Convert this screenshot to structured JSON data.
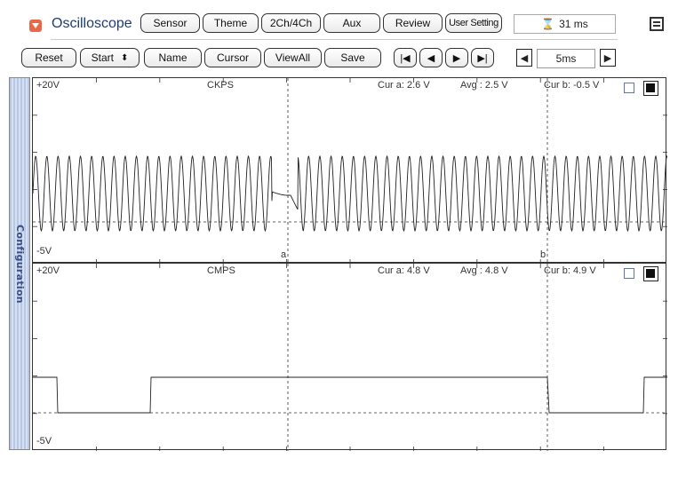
{
  "app": {
    "title": "Oscilloscope",
    "icon": "dropdown-arrow-icon"
  },
  "top_buttons": [
    "Sensor",
    "Theme",
    "2Ch/4Ch",
    "Aux",
    "Review",
    "User Setting"
  ],
  "time_display": {
    "value": "31 ms",
    "icon": "hourglass-icon"
  },
  "second_buttons": {
    "reset": "Reset",
    "start": "Start",
    "name": "Name",
    "cursor": "Cursor",
    "viewall": "ViewAll",
    "save": "Save"
  },
  "nav_icons": [
    "skip-first-icon",
    "step-back-icon",
    "step-forward-icon",
    "skip-last-icon"
  ],
  "timebase": {
    "value": "5ms"
  },
  "sidebar": {
    "label": "Configuration"
  },
  "channels": [
    {
      "name": "CKPS",
      "top": "+20V",
      "bottom": "-5V",
      "cur_a": "Cur a: 2.6 V",
      "avg": "Avg  : 2.5 V",
      "cur_b": "Cur b: -0.5 V",
      "cursor_a_label": "a",
      "cursor_b_label": "b",
      "trace_color": "#222222"
    },
    {
      "name": "CMPS",
      "top": "+20V",
      "bottom": "-5V",
      "cur_a": "Cur a: 4.8 V",
      "avg": "Avg  : 4.8 V",
      "cur_b": "Cur b: 4.9 V",
      "trace_color": "#222222"
    }
  ],
  "colors": {
    "sidebar": "#c4d2ec",
    "sidebar_text": "#3a4f86",
    "title_text": "#1f3b7a",
    "app_icon": "#e8684a"
  }
}
